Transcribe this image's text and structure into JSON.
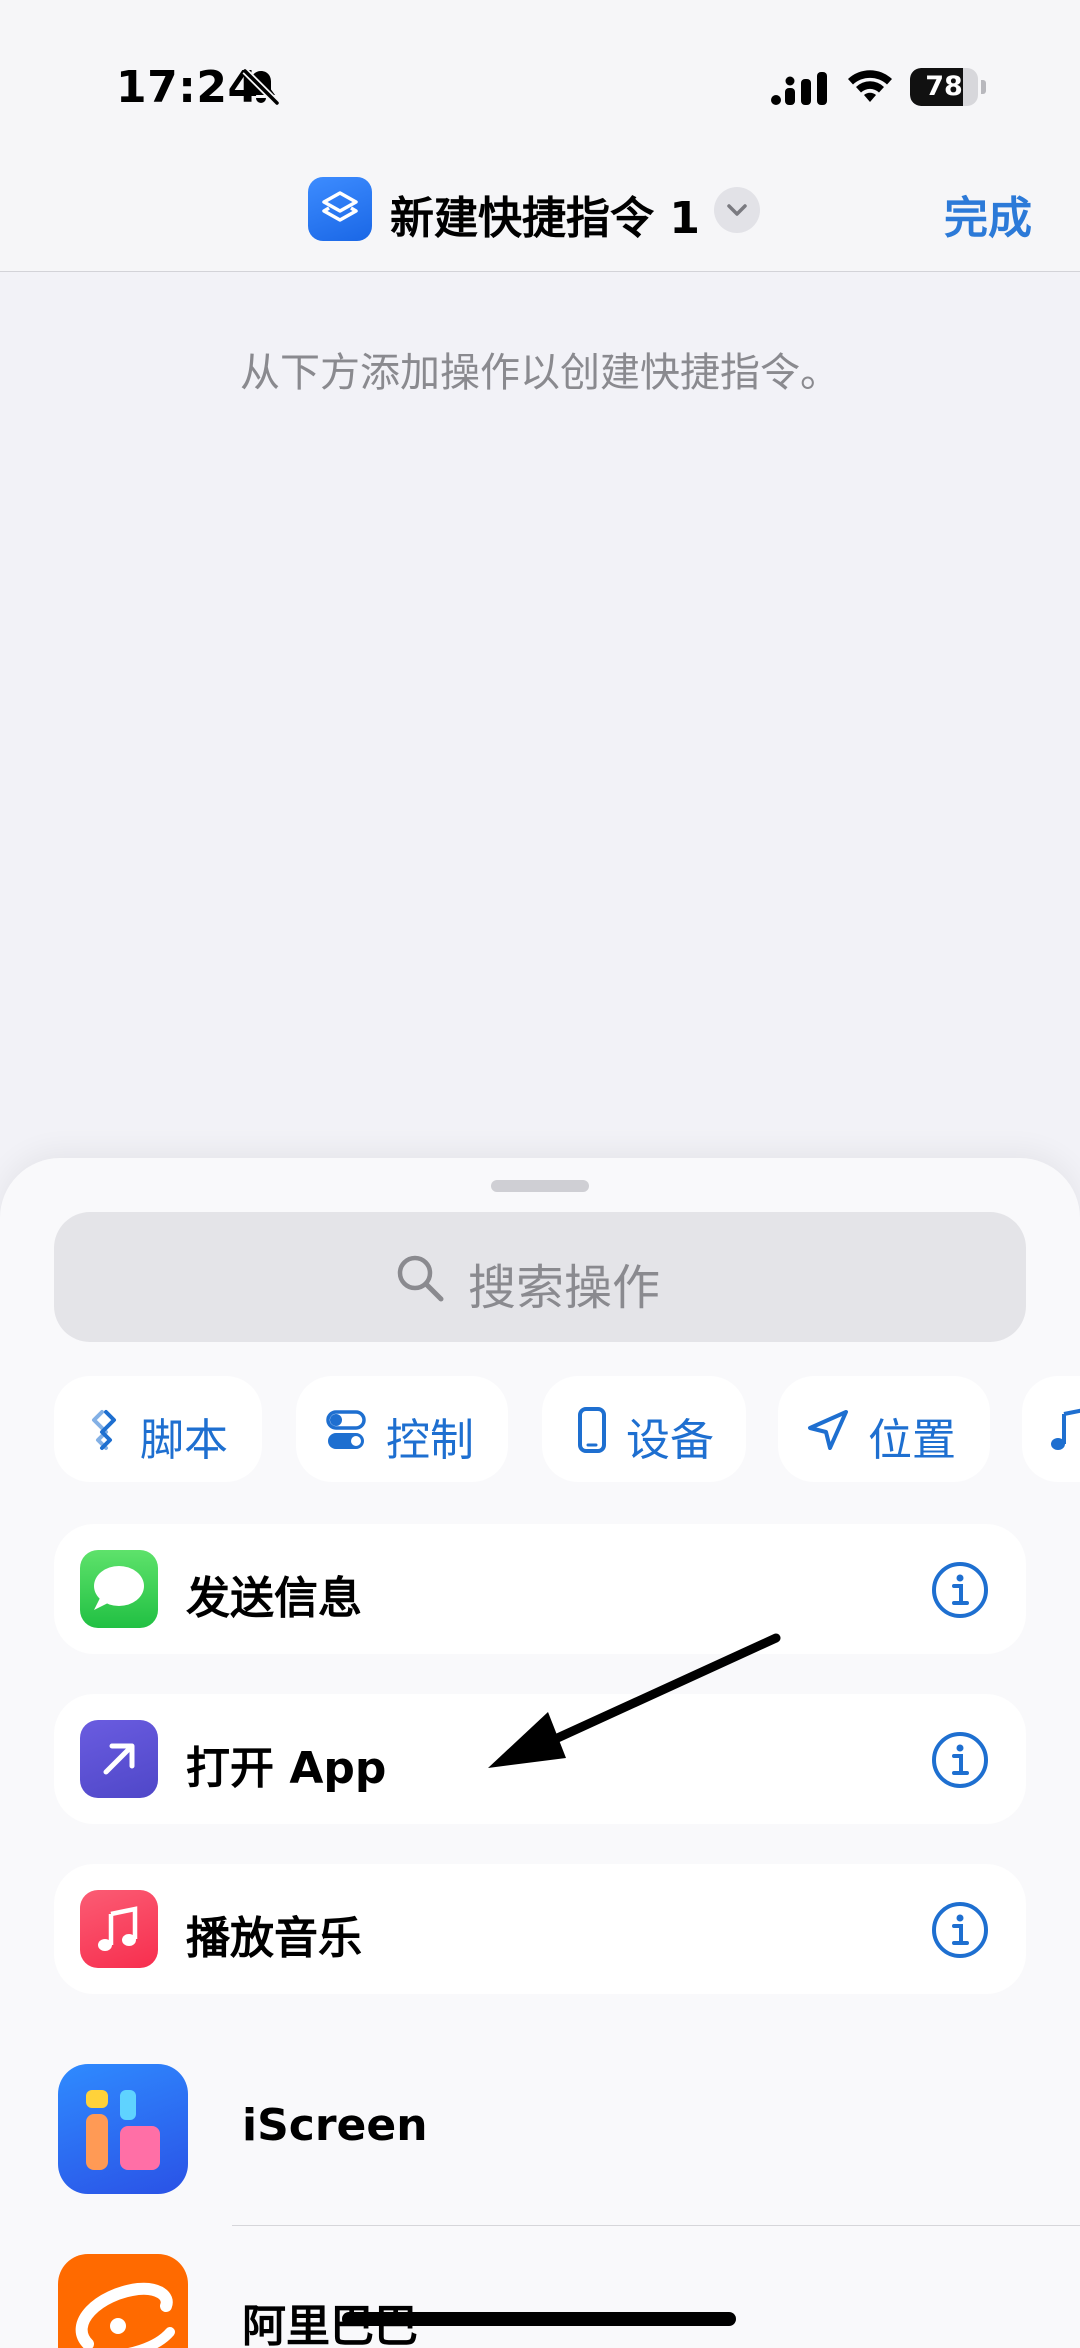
{
  "status_bar": {
    "time": "17:24",
    "battery_level": "78",
    "battery_fraction": 0.78
  },
  "nav": {
    "title": "新建快捷指令 1",
    "done_label": "完成",
    "app_icon": "shortcuts-icon",
    "accent_color": "#2c7ad8"
  },
  "main": {
    "empty_hint": "从下方添加操作以创建快捷指令。"
  },
  "sheet": {
    "search_placeholder": "搜索操作",
    "categories": [
      {
        "label": "脚本",
        "icon": "script-icon"
      },
      {
        "label": "控制",
        "icon": "toggle-icon"
      },
      {
        "label": "设备",
        "icon": "phone-icon"
      },
      {
        "label": "位置",
        "icon": "location-arrow-icon"
      },
      {
        "label": "",
        "icon": "music-note-icon"
      }
    ],
    "suggested_actions": [
      {
        "label": "发送信息",
        "icon": "messages-icon",
        "color": "#34c759"
      },
      {
        "label": "打开 App",
        "icon": "open-app-icon",
        "color": "#5a52d6"
      },
      {
        "label": "播放音乐",
        "icon": "music-icon",
        "color": "#fc3c44"
      }
    ],
    "apps": [
      {
        "label": "iScreen",
        "icon": "iscreen-icon"
      },
      {
        "label": "阿里巴巴",
        "icon": "alibaba-icon"
      }
    ]
  }
}
